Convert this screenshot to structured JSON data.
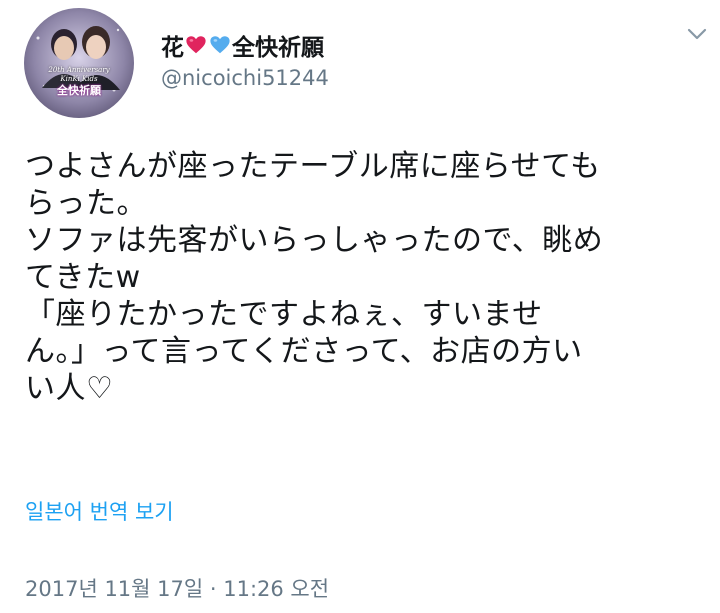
{
  "user": {
    "display_name_prefix": "花",
    "display_name_suffix": "全快祈願",
    "heart_colors": [
      "#e0245e",
      "#55acee"
    ],
    "handle": "@nicoichi51244",
    "avatar": {
      "caption_line1": "20th Anniversary",
      "caption_line2": "KinKi Kids",
      "caption_line3": "全快祈願"
    }
  },
  "tweet": {
    "text_lines": [
      "つよさんが座ったテーブル席に座らせても",
      "らった。",
      "ソファは先客がいらっしゃったので、眺め",
      "てきたw",
      "「座りたかったですよねぇ、すいませ",
      "ん。」って言ってくださって、お店の方い",
      "い人♡"
    ],
    "translate_link": "일본어 번역 보기",
    "timestamp": "2017년 11월 17일 · 11:26 오전"
  },
  "colors": {
    "text": "#14171a",
    "secondary": "#657786",
    "link": "#1da1f2"
  },
  "icons": {
    "menu": "chevron-down-icon",
    "heart_red": "red-heart-icon",
    "heart_blue": "blue-heart-icon"
  }
}
